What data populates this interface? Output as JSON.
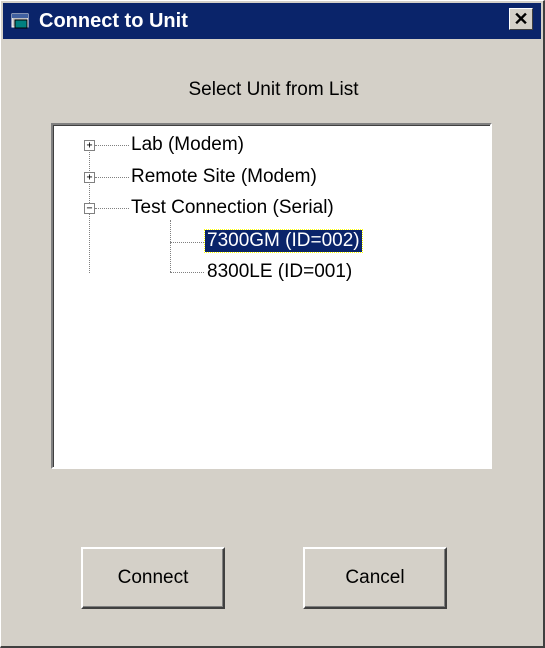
{
  "window": {
    "title": "Connect to Unit",
    "close_glyph": "✕",
    "icon": "app-window-icon"
  },
  "prompt": "Select Unit from List",
  "tree": {
    "nodes": [
      {
        "label": "Lab (Modem)",
        "expander": "+",
        "level": 0
      },
      {
        "label": "Remote Site (Modem)",
        "expander": "+",
        "level": 0
      },
      {
        "label": "Test Connection (Serial)",
        "expander": "−",
        "level": 0
      },
      {
        "label": "7300GM (ID=002)",
        "level": 1,
        "selected": true
      },
      {
        "label": "8300LE (ID=001)",
        "level": 1
      }
    ]
  },
  "buttons": {
    "connect": "Connect",
    "cancel": "Cancel"
  }
}
